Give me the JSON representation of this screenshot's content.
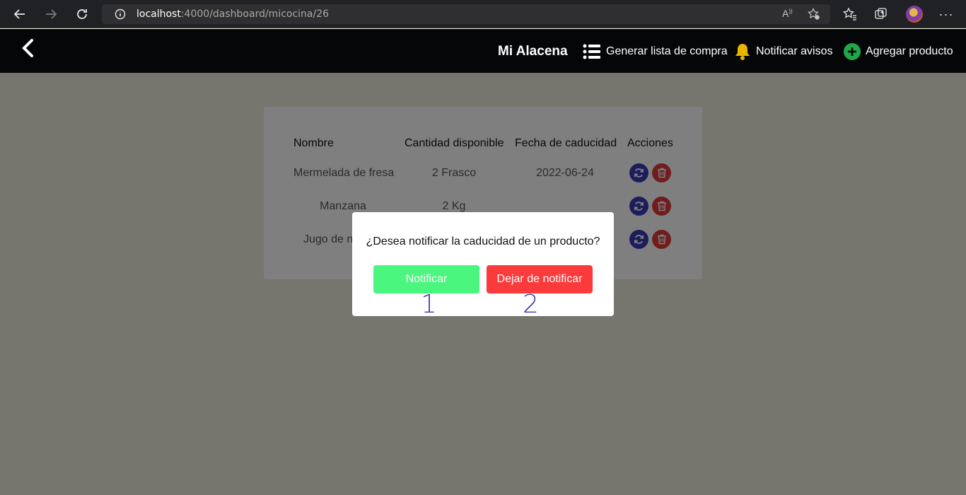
{
  "browser": {
    "url_host": "localhost",
    "url_path": ":4000/dashboard/micocina/26"
  },
  "header": {
    "brand": "Mi Alacena",
    "nav": {
      "shopping_list": "Generar lista de compra",
      "notify": "Notificar avisos",
      "add_product": "Agregar producto"
    }
  },
  "table": {
    "headers": [
      "Nombre",
      "Cantidad disponible",
      "Fecha de caducidad",
      "Acciones"
    ],
    "rows": [
      {
        "name": "Mermelada de fresa",
        "qty": "2 Frasco",
        "date": "2022-06-24"
      },
      {
        "name": "Manzana",
        "qty": "2 Kg",
        "date": ""
      },
      {
        "name": "Jugo de n",
        "qty": "",
        "date": ""
      }
    ]
  },
  "modal": {
    "message": "¿Desea notificar la caducidad de un producto?",
    "notify_label": "Notificar",
    "stop_label": "Dejar de notificar",
    "marker_1": "1",
    "marker_2": "2"
  },
  "colors": {
    "notify": "#4bf67e",
    "stop": "#fb3b3b",
    "action_refresh": "#3b3bb8",
    "action_delete": "#e03a3a",
    "bell": "#e8b400",
    "add": "#1fa84a"
  }
}
